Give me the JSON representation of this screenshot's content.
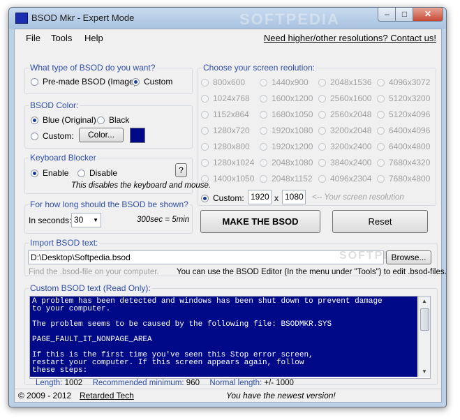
{
  "window": {
    "title": "BSOD Mkr - Expert Mode",
    "watermark": "SOFTPEDIA"
  },
  "menu": {
    "items": [
      "File",
      "Tools",
      "Help"
    ],
    "link": "Need higher/other resolutions? Contact us!"
  },
  "bsod_type": {
    "title": "What type of BSOD do you want?",
    "options": [
      "Pre-made BSOD (Image)",
      "Custom"
    ],
    "selected": "Custom"
  },
  "bsod_color": {
    "title": "BSOD Color:",
    "options": [
      "Blue (Original)",
      "Black",
      "Custom:"
    ],
    "selected": "Blue (Original)",
    "color_button": "Color...",
    "swatch_color": "#000a88"
  },
  "keyboard": {
    "title": "Keyboard Blocker",
    "options": [
      "Enable",
      "Disable"
    ],
    "selected": "Enable",
    "help_button": "?",
    "note": "This disables the keyboard and mouse."
  },
  "duration": {
    "title": "For how long should the BSOD be shown?",
    "label": "In seconds:",
    "value": "30",
    "hint": "300sec = 5min"
  },
  "resolution": {
    "title": "Choose your screen reolution:",
    "options": [
      [
        "800x600",
        "1440x900",
        "2048x1536",
        "4096x3072"
      ],
      [
        "1024x768",
        "1600x1200",
        "2560x1600",
        "5120x3200"
      ],
      [
        "1152x864",
        "1680x1050",
        "2560x2048",
        "5120x4096"
      ],
      [
        "1280x720",
        "1920x1080",
        "3200x2048",
        "6400x4096"
      ],
      [
        "1280x800",
        "1920x1200",
        "3200x2400",
        "6400x4800"
      ],
      [
        "1280x1024",
        "2048x1080",
        "3840x2400",
        "7680x4320"
      ],
      [
        "1400x1050",
        "2048x1152",
        "4096x2304",
        "7680x4800"
      ]
    ],
    "custom_label": "Custom:",
    "custom_width": "1920",
    "custom_x": "x",
    "custom_height": "1080",
    "custom_hint": "<-- Your screen resolution"
  },
  "actions": {
    "make": "MAKE THE BSOD",
    "reset": "Reset"
  },
  "import": {
    "title": "Import BSOD text:",
    "path": "D:\\Desktop\\Softpedia.bsod",
    "browse": "Browse...",
    "hint_left": "Find the .bsod-file on your computer.",
    "hint_right": "You can use the BSOD Editor (In the menu under \"Tools\") to edit .bsod-files."
  },
  "custom_text": {
    "title": "Custom BSOD text (Read Only):",
    "content": "A problem has been detected and windows has been shut down to prevent damage\nto your computer.\n\nThe problem seems to be caused by the following file: BSODMKR.SYS\n\nPAGE_FAULT_IT_NONPAGE_AREA\n\nIf this is the first time you've seen this Stop error screen,\nrestart your computer. If this screen appears again, follow\nthese steps:"
  },
  "stats": {
    "length_label": "Length:",
    "length_value": "1002",
    "min_label": "Recommended minimum:",
    "min_value": "960",
    "normal_label": "Normal length:",
    "normal_value": "+/- 1000"
  },
  "footer": {
    "copyright": "© 2009 - 2012",
    "company": "Retarded Tech",
    "status": "You have the newest version!"
  }
}
